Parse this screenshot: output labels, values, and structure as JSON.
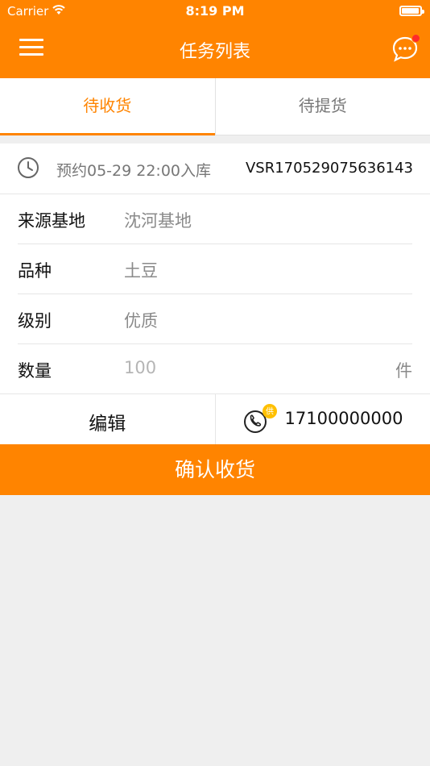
{
  "status_bar": {
    "carrier": "Carrier",
    "time": "8:19 PM",
    "battery_level": 0.95
  },
  "nav": {
    "title": "任务列表",
    "left_icon": "menu-icon",
    "right_icon": "chat-icon",
    "has_notification": true
  },
  "tabs": [
    {
      "label": "待收货",
      "active": true
    },
    {
      "label": "待提货",
      "active": false
    }
  ],
  "task": {
    "appointment": "预约05-29 22:00入库",
    "order_no": "VSR170529075636143",
    "fields": [
      {
        "label": "来源基地",
        "value": "沈河基地",
        "unit": ""
      },
      {
        "label": "品种",
        "value": "土豆",
        "unit": ""
      },
      {
        "label": "级别",
        "value": "优质",
        "unit": ""
      },
      {
        "label": "数量",
        "value": "100",
        "unit": "件"
      }
    ],
    "edit_label": "编辑",
    "supplier_badge": "供",
    "phone": "17100000000"
  },
  "confirm_label": "确认收货",
  "colors": {
    "accent": "#ff8400",
    "notification": "#ff2a2a",
    "badge": "#ffc000"
  }
}
